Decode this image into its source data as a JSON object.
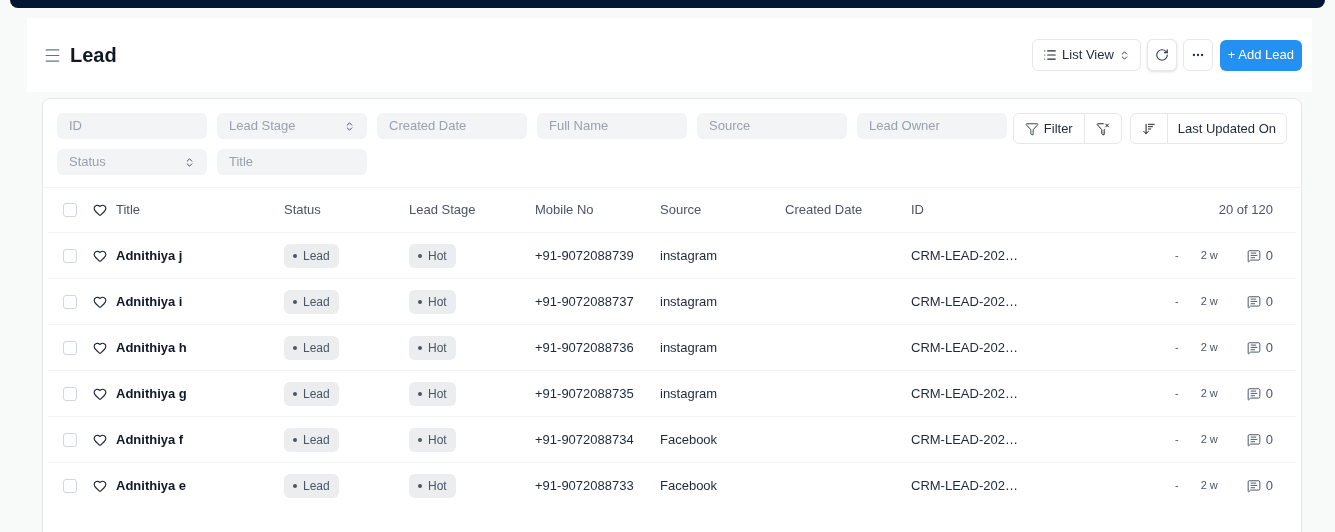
{
  "header": {
    "title": "Lead",
    "view_button": "List View",
    "add_button": "+ Add Lead"
  },
  "filters": [
    {
      "kind": "text",
      "placeholder": "ID"
    },
    {
      "kind": "select",
      "placeholder": "Lead Stage"
    },
    {
      "kind": "text",
      "placeholder": "Created Date"
    },
    {
      "kind": "text",
      "placeholder": "Full Name"
    },
    {
      "kind": "text",
      "placeholder": "Source"
    },
    {
      "kind": "text",
      "placeholder": "Lead Owner"
    },
    {
      "kind": "select",
      "placeholder": "Status"
    },
    {
      "kind": "text",
      "placeholder": "Title"
    }
  ],
  "filter_button": "Filter",
  "sort_button": "Last Updated On",
  "table": {
    "columns": [
      "Title",
      "Status",
      "Lead Stage",
      "Mobile No",
      "Source",
      "Created Date",
      "ID"
    ],
    "count": "20 of 120",
    "select_all_checked": false,
    "rows": [
      {
        "title": "Adnithiya j",
        "status": "Lead",
        "stage": "Hot",
        "mobile": "+91-9072088739",
        "source": "instagram",
        "id": "CRM-LEAD-202…",
        "owner": "-",
        "age": "2 w",
        "comments": "0",
        "checked": false,
        "liked": false
      },
      {
        "title": "Adnithiya i",
        "status": "Lead",
        "stage": "Hot",
        "mobile": "+91-9072088737",
        "source": "instagram",
        "id": "CRM-LEAD-202…",
        "owner": "-",
        "age": "2 w",
        "comments": "0",
        "checked": false,
        "liked": false
      },
      {
        "title": "Adnithiya h",
        "status": "Lead",
        "stage": "Hot",
        "mobile": "+91-9072088736",
        "source": "instagram",
        "id": "CRM-LEAD-202…",
        "owner": "-",
        "age": "2 w",
        "comments": "0",
        "checked": false,
        "liked": false
      },
      {
        "title": "Adnithiya g",
        "status": "Lead",
        "stage": "Hot",
        "mobile": "+91-9072088735",
        "source": "instagram",
        "id": "CRM-LEAD-202…",
        "owner": "-",
        "age": "2 w",
        "comments": "0",
        "checked": false,
        "liked": false
      },
      {
        "title": "Adnithiya f",
        "status": "Lead",
        "stage": "Hot",
        "mobile": "+91-9072088734",
        "source": "Facebook",
        "id": "CRM-LEAD-202…",
        "owner": "-",
        "age": "2 w",
        "comments": "0",
        "checked": false,
        "liked": false
      },
      {
        "title": "Adnithiya e",
        "status": "Lead",
        "stage": "Hot",
        "mobile": "+91-9072088733",
        "source": "Facebook",
        "id": "CRM-LEAD-202…",
        "owner": "-",
        "age": "2 w",
        "comments": "0",
        "checked": false,
        "liked": false
      }
    ]
  }
}
